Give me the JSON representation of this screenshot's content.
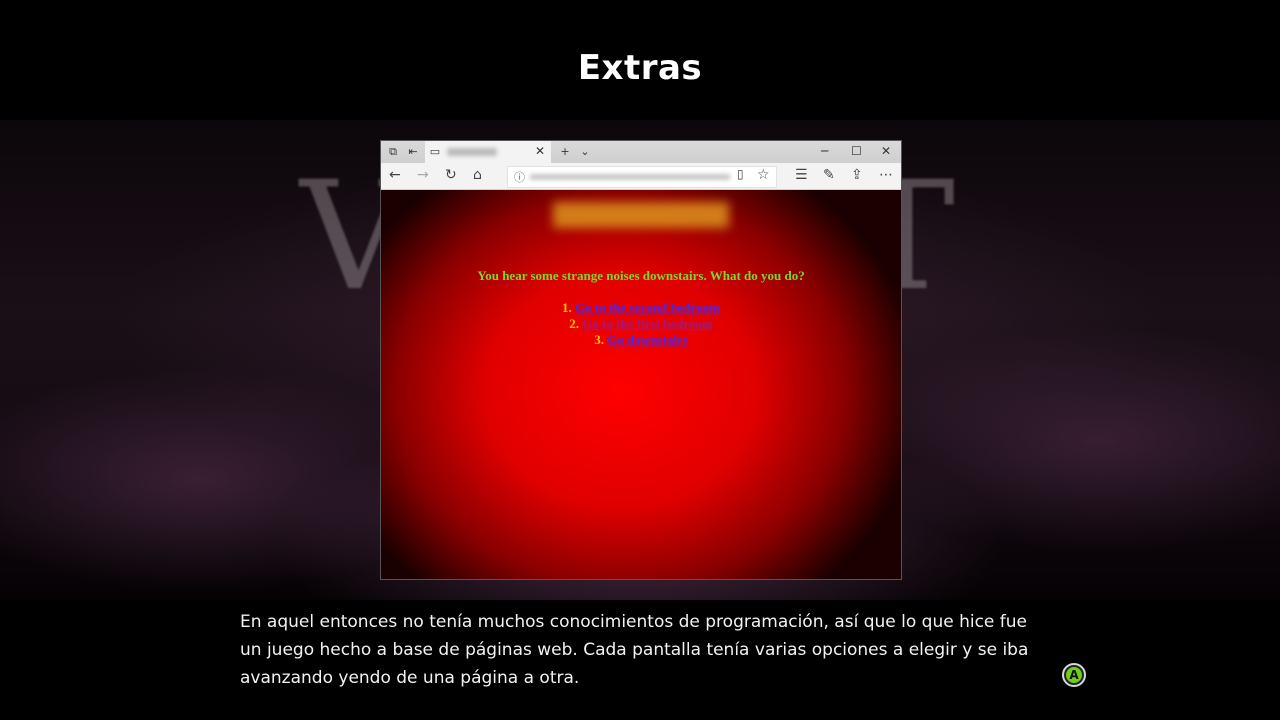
{
  "header": {
    "title": "Extras"
  },
  "background": {
    "title_left": "V",
    "title_right": "T"
  },
  "screenshot": {
    "browser": {
      "tab_close": "✕",
      "new_tab": "+",
      "tab_menu": "⌄",
      "window_minimize": "─",
      "window_maximize": "☐",
      "window_close": "✕"
    },
    "page": {
      "question": "You hear some strange noises downstairs. What do you do?",
      "options": [
        {
          "number": "1.",
          "label": "Go to the second bedroom"
        },
        {
          "number": "2.",
          "label": "Go to the first bedroom"
        },
        {
          "number": "3.",
          "label": "Go downstairs"
        }
      ]
    }
  },
  "caption": {
    "text": "En aquel entonces no tenía muchos conocimientos de programación, así que lo que hice fue un juego hecho a base de páginas web. Cada pantalla tenía varias opciones a elegir y se iba avanzando yendo de una página a otra."
  },
  "controls": {
    "confirm_button_label": "A"
  },
  "colors": {
    "question": "#7ad82a",
    "option_number": "#f5c400",
    "link": "#3a2cff",
    "visited_link": "#9b1a8a",
    "a_button": "#6bd11a"
  }
}
